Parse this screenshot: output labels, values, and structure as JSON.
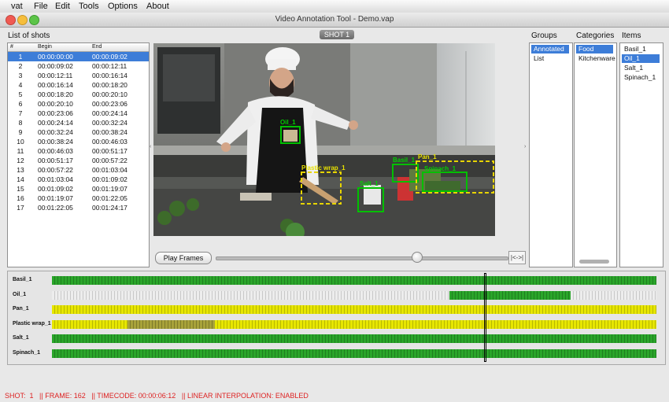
{
  "menubar": {
    "items": [
      "vat",
      "File",
      "Edit",
      "Tools",
      "Options",
      "About"
    ]
  },
  "window": {
    "title": "Video Annotation Tool - Demo.vap"
  },
  "shots_list": {
    "title": "List of shots",
    "columns": [
      "#",
      "Begin",
      "End"
    ],
    "selected_index": 0,
    "rows": [
      [
        "1",
        "00:00:00:00",
        "00:00:09:02"
      ],
      [
        "2",
        "00:00:09:02",
        "00:00:12:11"
      ],
      [
        "3",
        "00:00:12:11",
        "00:00:16:14"
      ],
      [
        "4",
        "00:00:16:14",
        "00:00:18:20"
      ],
      [
        "5",
        "00:00:18:20",
        "00:00:20:10"
      ],
      [
        "6",
        "00:00:20:10",
        "00:00:23:06"
      ],
      [
        "7",
        "00:00:23:06",
        "00:00:24:14"
      ],
      [
        "8",
        "00:00:24:14",
        "00:00:32:24"
      ],
      [
        "9",
        "00:00:32:24",
        "00:00:38:24"
      ],
      [
        "10",
        "00:00:38:24",
        "00:00:46:03"
      ],
      [
        "11",
        "00:00:46:03",
        "00:00:51:17"
      ],
      [
        "12",
        "00:00:51:17",
        "00:00:57:22"
      ],
      [
        "13",
        "00:00:57:22",
        "00:01:03:04"
      ],
      [
        "14",
        "00:01:03:04",
        "00:01:09:02"
      ],
      [
        "15",
        "00:01:09:02",
        "00:01:19:07"
      ],
      [
        "16",
        "00:01:19:07",
        "00:01:22:05"
      ],
      [
        "17",
        "00:01:22:05",
        "00:01:24:17"
      ]
    ]
  },
  "video": {
    "shot_label": "SHOT 1",
    "annotations": [
      "Oil_1",
      "Plastic wrap_1",
      "Salt_1",
      "Basil_1",
      "Pan_1",
      "Spinach_1"
    ]
  },
  "controls": {
    "play_label": "Play Frames",
    "end_label": "|<->|",
    "slider_fraction": 0.69
  },
  "groups": {
    "title": "Groups",
    "items": [
      "Annotated",
      "List"
    ],
    "selected": 0
  },
  "categories": {
    "title": "Categories",
    "items": [
      "Food",
      "Kitchenware"
    ],
    "selected": 0
  },
  "items": {
    "title": "Items",
    "items": [
      "Basil_1",
      "Oil_1",
      "Salt_1",
      "Spinach_1"
    ],
    "selected": 1
  },
  "timeline": {
    "playhead_fraction": 0.716,
    "tracks": [
      {
        "label": "Basil_1",
        "color": "#2aa52a",
        "segments": [
          [
            0,
            1,
            "green"
          ]
        ]
      },
      {
        "label": "Oil_1",
        "color": "#2aa52a",
        "segments": [
          [
            0,
            0.658,
            "empty"
          ],
          [
            0.658,
            0.858,
            "green"
          ],
          [
            0.858,
            1,
            "empty"
          ]
        ]
      },
      {
        "label": "Pan_1",
        "color": "#e7e600",
        "segments": [
          [
            0,
            1,
            "yellow"
          ]
        ]
      },
      {
        "label": "Plastic wrap_1",
        "color": "#e7e600",
        "segments": [
          [
            0,
            0.125,
            "yellow"
          ],
          [
            0.125,
            0.27,
            "olive"
          ],
          [
            0.27,
            1,
            "yellow"
          ]
        ]
      },
      {
        "label": "Salt_1",
        "color": "#2aa52a",
        "segments": [
          [
            0,
            1,
            "green"
          ]
        ]
      },
      {
        "label": "Spinach_1",
        "color": "#2aa52a",
        "segments": [
          [
            0,
            1,
            "green"
          ]
        ]
      }
    ]
  },
  "status": {
    "shot": "SHOT:  1",
    "frame": "|| FRAME: 162",
    "timecode": "|| TIMECODE: 00:00:06:12",
    "interp": "|| LINEAR INTERPOLATION: ENABLED"
  },
  "colors": {
    "selection": "#3d7dd8",
    "annotation_box": "#00c000",
    "interp_box": "#e7d400",
    "status_text": "#dd2222"
  }
}
